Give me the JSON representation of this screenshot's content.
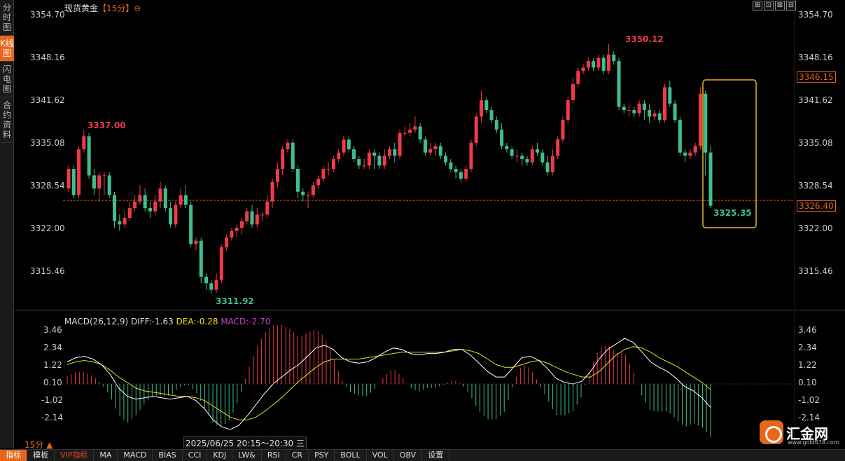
{
  "side_tabs": [
    "分时图",
    "K线图",
    "闪电图",
    "合约资料"
  ],
  "active_side_tab": 1,
  "title": "现货黄金",
  "period_bracket": "【15分】",
  "title_icon": "⊖",
  "window_buttons": [
    "⊞",
    "⊡",
    "⊠",
    "⊟"
  ],
  "price_axis_labels": [
    "3354.70",
    "3348.16",
    "3341.62",
    "3335.08",
    "3328.54",
    "3322.00",
    "3315.46"
  ],
  "price_axis_values": [
    3354.7,
    3348.16,
    3341.62,
    3335.08,
    3328.54,
    3322.0,
    3315.46
  ],
  "current_price": "3346.15",
  "last_price": "3326.40",
  "annotations": {
    "high_left": "3337.00",
    "high": "3350.12",
    "low": "3311.92",
    "last_low": "3325.35"
  },
  "macd_axis_labels": [
    "3.46",
    "2.34",
    "1.22",
    "0.10",
    "-1.02",
    "-2.14"
  ],
  "macd_axis_values": [
    3.46,
    2.34,
    1.22,
    0.1,
    -1.02,
    -2.14
  ],
  "macd_legend": {
    "name": "MACD(26,12,9)",
    "diff": "DIFF:-1.63",
    "dea": "DEA:-0.28",
    "macd": "MACD:-2.70"
  },
  "period_label": "15分 ▲",
  "time_label": "2025/06/25 20:15～20:30 三",
  "bottom_items": [
    "指标",
    "模板",
    "VIP指标",
    "MA",
    "MACD",
    "BIAS",
    "CCI",
    "KDJ",
    "LW&",
    "RSI",
    "CR",
    "PSY",
    "BOLL",
    "VOL",
    "OBV",
    "设置"
  ],
  "logo_text": "汇金网",
  "logo_url": "www.gold678.com",
  "colors": {
    "up": "#ef3b47",
    "down": "#3fbf8f",
    "accent": "#e8651a",
    "highlight_box": "#e8b81a",
    "diff_line": "#ffffff",
    "dea_line": "#e8e01a",
    "macd_text": "#d040d0"
  },
  "chart_data": [
    {
      "type": "candlestick",
      "title": "现货黄金【15分】",
      "ylim": [
        3311.92,
        3354.7
      ],
      "candles": [
        [
          3328,
          3331,
          3327.5,
          3331.5
        ],
        [
          3331,
          3327,
          3326.5,
          3331.5
        ],
        [
          3327,
          3334,
          3326.5,
          3334.5
        ],
        [
          3334,
          3336,
          3333.5,
          3337
        ],
        [
          3336,
          3330,
          3329.5,
          3336.5
        ],
        [
          3330,
          3328,
          3327,
          3331
        ],
        [
          3328,
          3330,
          3326,
          3330.5
        ],
        [
          3330,
          3330,
          3327,
          3330.5
        ],
        [
          3330,
          3327,
          3326.5,
          3330.5
        ],
        [
          3327,
          3323,
          3322,
          3327.5
        ],
        [
          3323,
          3322.5,
          3321.5,
          3324
        ],
        [
          3322.5,
          3323.5,
          3322,
          3324.5
        ],
        [
          3323.5,
          3325,
          3323,
          3326
        ],
        [
          3325,
          3326,
          3324.5,
          3327
        ],
        [
          3326,
          3327,
          3325.5,
          3328.5
        ],
        [
          3327,
          3325,
          3324.5,
          3328
        ],
        [
          3325,
          3324.5,
          3323.5,
          3326
        ],
        [
          3324.5,
          3326,
          3324,
          3327
        ],
        [
          3326,
          3328,
          3325,
          3329
        ],
        [
          3328,
          3325,
          3324.5,
          3328.5
        ],
        [
          3325,
          3322.5,
          3322,
          3326
        ],
        [
          3322.5,
          3325.5,
          3322,
          3326
        ],
        [
          3325.5,
          3327,
          3325,
          3328
        ],
        [
          3327,
          3325.5,
          3325,
          3328.5
        ],
        [
          3325.5,
          3319.5,
          3319,
          3326
        ],
        [
          3319.5,
          3320,
          3318.5,
          3320.5
        ],
        [
          3320,
          3314.5,
          3313.5,
          3320.5
        ],
        [
          3314.5,
          3313.5,
          3312.5,
          3315
        ],
        [
          3313.5,
          3312.5,
          3311.92,
          3314
        ],
        [
          3312.5,
          3314,
          3312,
          3315
        ],
        [
          3314,
          3319,
          3313.5,
          3319.5
        ],
        [
          3319,
          3320.5,
          3318.5,
          3321
        ],
        [
          3320.5,
          3321.5,
          3320,
          3322
        ],
        [
          3321.5,
          3322,
          3320.5,
          3322.5
        ],
        [
          3322,
          3323,
          3321,
          3323.5
        ],
        [
          3323,
          3324.5,
          3322.5,
          3325
        ],
        [
          3324.5,
          3322.5,
          3322,
          3325.5
        ],
        [
          3322.5,
          3324,
          3322,
          3325
        ],
        [
          3324,
          3324,
          3323,
          3324.5
        ],
        [
          3324,
          3326,
          3323.5,
          3327
        ],
        [
          3326,
          3329,
          3325,
          3329.5
        ],
        [
          3329,
          3331,
          3328,
          3332
        ],
        [
          3331,
          3334,
          3330,
          3334.5
        ],
        [
          3334,
          3335,
          3333.5,
          3335.5
        ],
        [
          3335,
          3331,
          3330.5,
          3335.5
        ],
        [
          3331,
          3327.5,
          3326.5,
          3331.5
        ],
        [
          3327.5,
          3327,
          3326,
          3328
        ],
        [
          3327,
          3327,
          3325,
          3327.5
        ],
        [
          3327,
          3328.5,
          3326.5,
          3329
        ],
        [
          3328.5,
          3329.5,
          3328,
          3330
        ],
        [
          3329.5,
          3331,
          3329,
          3331.5
        ],
        [
          3331,
          3331,
          3330,
          3332
        ],
        [
          3331,
          3332.5,
          3330.5,
          3333
        ],
        [
          3332.5,
          3333.5,
          3332,
          3334
        ],
        [
          3333.5,
          3335.5,
          3333,
          3336
        ],
        [
          3335.5,
          3334,
          3333.5,
          3336
        ],
        [
          3334,
          3332.5,
          3332,
          3334.5
        ],
        [
          3332.5,
          3331.5,
          3331,
          3333
        ],
        [
          3331.5,
          3331.5,
          3331,
          3332.5
        ],
        [
          3331.5,
          3333.5,
          3331,
          3334
        ],
        [
          3333.5,
          3333,
          3331,
          3334
        ],
        [
          3333,
          3331.5,
          3331,
          3333.5
        ],
        [
          3331.5,
          3333,
          3331,
          3334
        ],
        [
          3333,
          3334,
          3332.5,
          3334.5
        ],
        [
          3334,
          3333,
          3332,
          3335
        ],
        [
          3333,
          3336.5,
          3332.5,
          3337
        ],
        [
          3336.5,
          3336.5,
          3336,
          3337.5
        ],
        [
          3336.5,
          3337,
          3336,
          3338
        ],
        [
          3337,
          3337.5,
          3336.5,
          3339
        ],
        [
          3337.5,
          3335.5,
          3335,
          3338
        ],
        [
          3335.5,
          3333.5,
          3333,
          3336
        ],
        [
          3333.5,
          3334,
          3333,
          3335
        ],
        [
          3334,
          3334.5,
          3333,
          3335
        ],
        [
          3334.5,
          3333,
          3332.5,
          3335
        ],
        [
          3333,
          3332,
          3331.5,
          3333.5
        ],
        [
          3332,
          3331,
          3330.5,
          3332.5
        ],
        [
          3331,
          3330.5,
          3329.5,
          3331.5
        ],
        [
          3330.5,
          3329.5,
          3329,
          3331
        ],
        [
          3329.5,
          3331,
          3329,
          3331.5
        ],
        [
          3331,
          3335,
          3330.5,
          3335.5
        ],
        [
          3335,
          3339,
          3334.5,
          3339.5
        ],
        [
          3339,
          3341.5,
          3338,
          3343
        ],
        [
          3341.5,
          3340,
          3339.5,
          3342
        ],
        [
          3340,
          3338.5,
          3338,
          3340.5
        ],
        [
          3338.5,
          3337,
          3336.5,
          3339
        ],
        [
          3337,
          3334.5,
          3334,
          3338
        ],
        [
          3334.5,
          3334,
          3333.5,
          3335
        ],
        [
          3334,
          3333,
          3332.5,
          3334.5
        ],
        [
          3333,
          3333,
          3332,
          3334
        ],
        [
          3333,
          3332.5,
          3331.5,
          3333.5
        ],
        [
          3332.5,
          3332,
          3331.5,
          3333
        ],
        [
          3332,
          3334,
          3331.5,
          3334.5
        ],
        [
          3334,
          3333.5,
          3333,
          3335
        ],
        [
          3333.5,
          3332,
          3331.5,
          3334
        ],
        [
          3332,
          3330.5,
          3330,
          3333
        ],
        [
          3330.5,
          3333,
          3330,
          3334
        ],
        [
          3333,
          3335.5,
          3332.5,
          3336
        ],
        [
          3335.5,
          3338.5,
          3335,
          3339
        ],
        [
          3338.5,
          3341.5,
          3338,
          3342
        ],
        [
          3341.5,
          3344,
          3341,
          3345
        ],
        [
          3344,
          3346,
          3343.5,
          3346.5
        ],
        [
          3346,
          3346.5,
          3345.5,
          3347
        ],
        [
          3346.5,
          3347.5,
          3346,
          3348
        ],
        [
          3347.5,
          3346.5,
          3346,
          3348
        ],
        [
          3346.5,
          3348,
          3346,
          3348.5
        ],
        [
          3348,
          3346,
          3345.5,
          3348.5
        ],
        [
          3346,
          3348.5,
          3345.5,
          3350.12
        ],
        [
          3348.5,
          3347.5,
          3347,
          3349
        ],
        [
          3347.5,
          3340.5,
          3340,
          3348
        ],
        [
          3340.5,
          3340,
          3339.5,
          3341
        ],
        [
          3340,
          3340,
          3339,
          3341
        ],
        [
          3340,
          3339.5,
          3339,
          3340.5
        ],
        [
          3339.5,
          3341,
          3339,
          3341.5
        ],
        [
          3341,
          3340,
          3338.5,
          3341.5
        ],
        [
          3340,
          3339,
          3338,
          3341
        ],
        [
          3339,
          3339.5,
          3338.5,
          3340
        ],
        [
          3339.5,
          3338.5,
          3338,
          3340
        ],
        [
          3338.5,
          3343.5,
          3338,
          3344
        ],
        [
          3343.5,
          3341,
          3340.5,
          3344.5
        ],
        [
          3341,
          3338.5,
          3338,
          3341.5
        ],
        [
          3338.5,
          3333.5,
          3333,
          3339
        ],
        [
          3333.5,
          3333,
          3332,
          3334
        ],
        [
          3333,
          3333.5,
          3332.5,
          3334
        ],
        [
          3333.5,
          3334.5,
          3333,
          3335
        ],
        [
          3334.5,
          3342.5,
          3334,
          3343.5
        ],
        [
          3342.5,
          3333.5,
          3330,
          3343
        ],
        [
          3333.5,
          3325.35,
          3325,
          3334.5
        ]
      ]
    },
    {
      "type": "line",
      "title": "MACD(26,12,9)",
      "ylim": [
        -3.2,
        3.9
      ],
      "series": [
        {
          "name": "DIFF",
          "values": [
            1.7,
            2.0,
            2.1,
            1.9,
            1.5,
            0.8,
            -0.2,
            -0.8,
            -1.0,
            -0.9,
            -0.8,
            -0.9,
            -1.0,
            -0.9,
            -0.8,
            -1.1,
            -1.7,
            -2.5,
            -3.0,
            -3.2,
            -2.9,
            -2.2,
            -1.4,
            -0.6,
            0.1,
            0.6,
            1.1,
            1.5,
            2.1,
            2.7,
            2.9,
            2.6,
            2.0,
            1.7,
            1.6,
            1.7,
            2.0,
            2.4,
            2.7,
            2.6,
            2.3,
            2.2,
            2.3,
            2.3,
            2.4,
            2.6,
            2.6,
            2.2,
            1.6,
            1.0,
            0.6,
            0.6,
            1.3,
            2.0,
            2.1,
            1.8,
            1.2,
            0.5,
            0.2,
            0.1,
            0.3,
            1.0,
            1.9,
            2.6,
            3.0,
            3.4,
            3.1,
            2.4,
            1.7,
            1.3,
            1.0,
            0.5,
            -0.1,
            -0.4,
            -0.9,
            -1.6
          ]
        },
        {
          "name": "DEA",
          "values": [
            1.5,
            1.7,
            1.8,
            1.7,
            1.5,
            1.1,
            0.6,
            0.2,
            -0.2,
            -0.4,
            -0.5,
            -0.6,
            -0.7,
            -0.8,
            -0.8,
            -0.9,
            -1.1,
            -1.5,
            -1.9,
            -2.3,
            -2.5,
            -2.5,
            -2.3,
            -1.9,
            -1.4,
            -0.9,
            -0.3,
            0.3,
            0.8,
            1.3,
            1.7,
            1.9,
            1.9,
            1.9,
            1.9,
            2.0,
            2.1,
            2.2,
            2.3,
            2.4,
            2.4,
            2.4,
            2.4,
            2.4,
            2.4,
            2.5,
            2.6,
            2.5,
            2.3,
            1.9,
            1.5,
            1.3,
            1.3,
            1.5,
            1.7,
            1.8,
            1.6,
            1.3,
            1.0,
            0.8,
            0.6,
            0.6,
            1.0,
            1.6,
            2.2,
            2.6,
            2.8,
            2.7,
            2.4,
            2.0,
            1.7,
            1.4,
            1.0,
            0.6,
            0.2,
            -0.3
          ]
        },
        {
          "name": "MACD",
          "values": [
            0.4,
            0.6,
            0.6,
            0.4,
            0.0,
            -0.6,
            -1.6,
            -2.0,
            -1.6,
            -1.0,
            -0.6,
            -0.6,
            -0.6,
            -0.2,
            0.0,
            -0.4,
            -1.2,
            -2.0,
            -2.2,
            -1.8,
            -0.8,
            0.6,
            1.8,
            2.6,
            3.0,
            3.0,
            2.8,
            2.4,
            2.6,
            2.8,
            2.4,
            1.4,
            0.2,
            -0.4,
            -0.6,
            -0.6,
            -0.2,
            0.4,
            0.8,
            0.4,
            -0.2,
            -0.4,
            -0.2,
            -0.2,
            0.0,
            0.2,
            0.0,
            -0.6,
            -1.4,
            -1.8,
            -1.8,
            -1.4,
            0.0,
            1.0,
            0.8,
            0.0,
            -0.8,
            -1.6,
            -1.6,
            -1.4,
            -0.6,
            0.8,
            1.8,
            2.0,
            1.6,
            1.6,
            0.6,
            -0.6,
            -1.4,
            -1.4,
            -1.4,
            -1.8,
            -2.2,
            -2.0,
            -2.2,
            -2.7
          ]
        }
      ]
    }
  ]
}
